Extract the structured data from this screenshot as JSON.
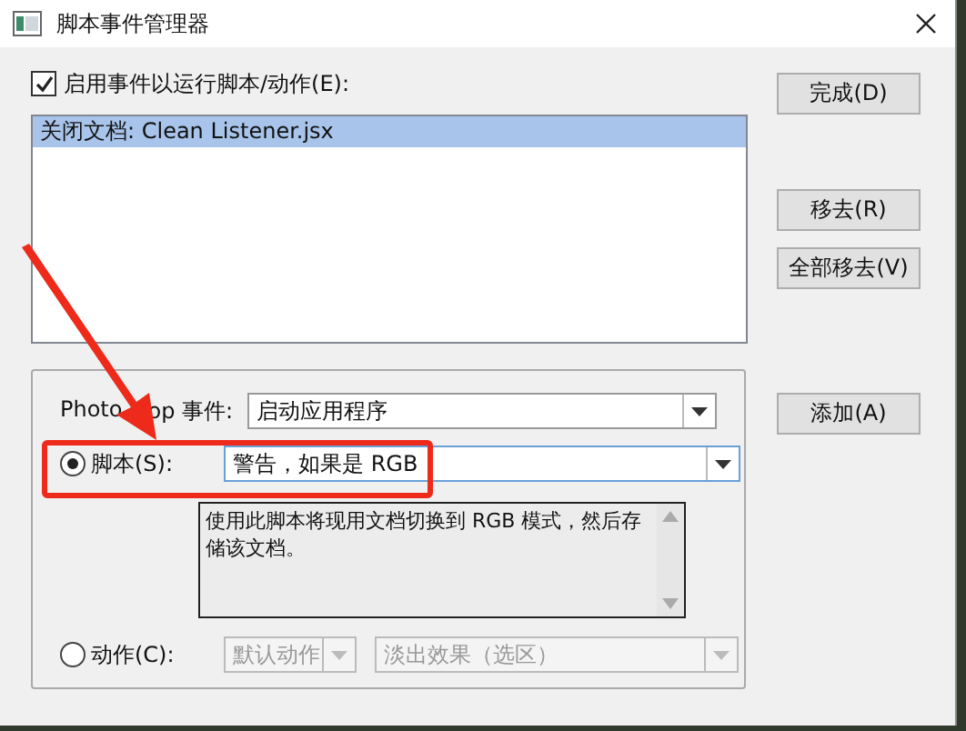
{
  "window": {
    "title": "脚本事件管理器"
  },
  "enable": {
    "label": "启用事件以运行脚本/动作(E):",
    "checked": true
  },
  "events_list": [
    {
      "text": "关闭文档: Clean Listener.jsx",
      "selected": true
    }
  ],
  "side_buttons": [
    {
      "label": "完成(D)"
    },
    {
      "label": "移去(R)"
    },
    {
      "label": "全部移去(V)"
    },
    {
      "label": "添加(A)"
    }
  ],
  "event": {
    "label_start": "Photo",
    "label_end": "op 事件:",
    "value": "启动应用程序"
  },
  "script": {
    "label": "脚本(S):",
    "selected": true,
    "value": "警告，如果是 RGB",
    "description": "使用此脚本将现用文档切换到 RGB 模式，然后存储该文档。"
  },
  "action": {
    "label": "动作(C):",
    "selected": false,
    "set": "默认动作",
    "value": "淡出效果（选区）"
  }
}
